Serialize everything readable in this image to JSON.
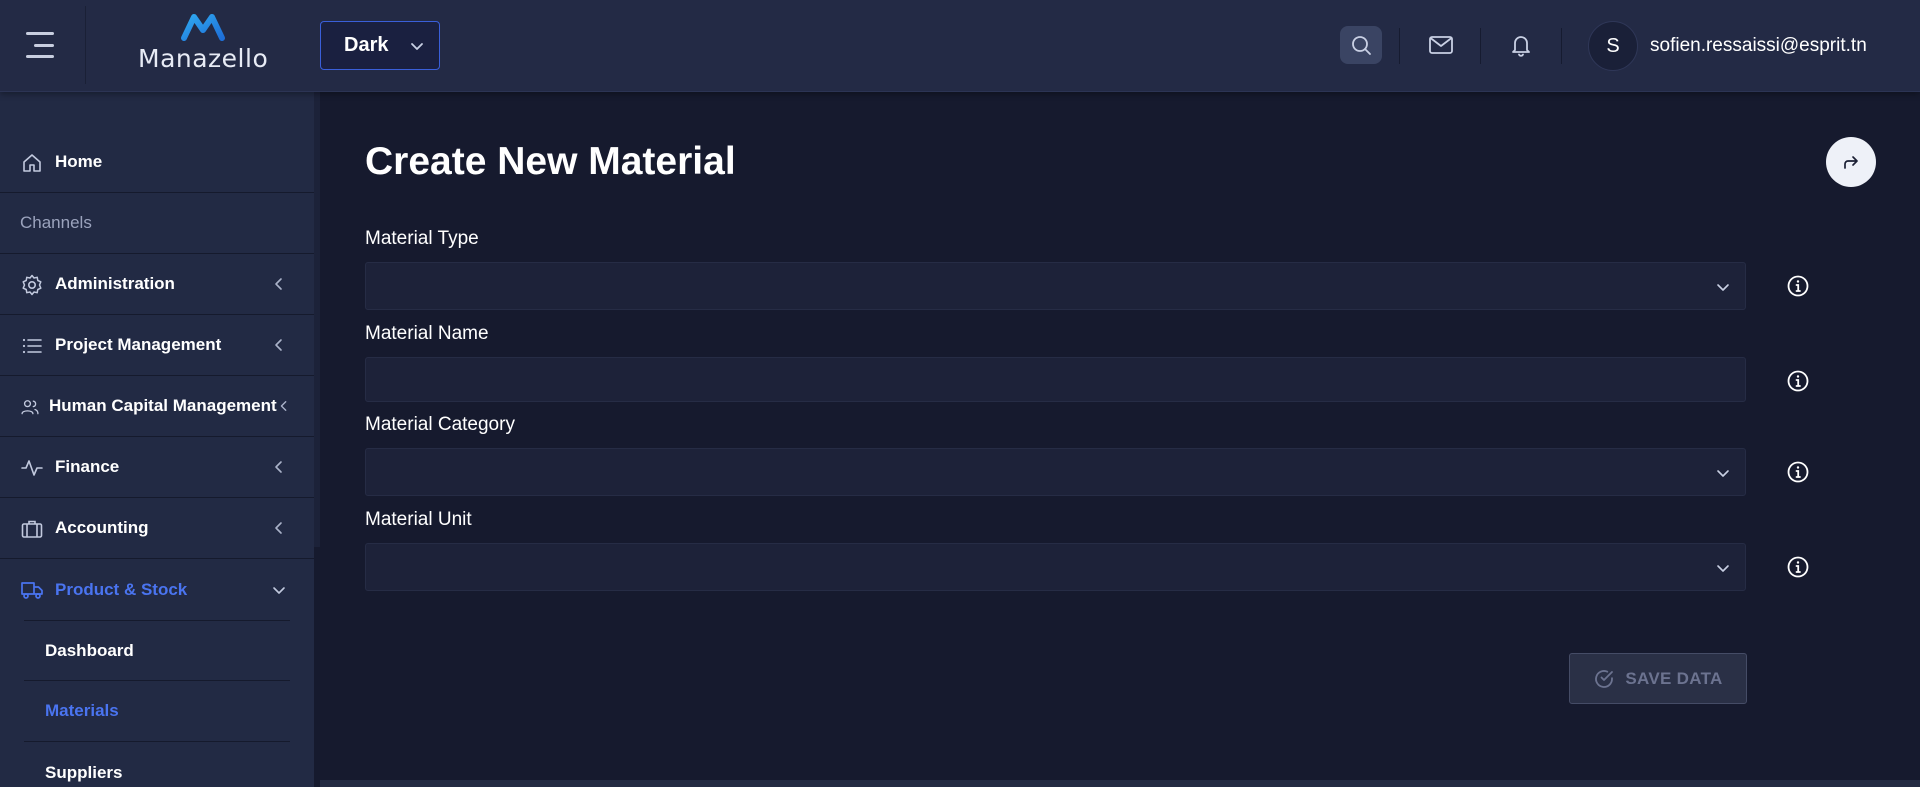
{
  "header": {
    "brand": "Manazello",
    "theme": {
      "selected": "Dark"
    },
    "user": {
      "initial": "S",
      "email": "sofien.ressaissi@esprit.tn"
    }
  },
  "sidebar": {
    "items": [
      {
        "label": "Home",
        "icon": "home-icon"
      },
      {
        "label": "Channels",
        "heading": true
      },
      {
        "label": "Administration",
        "icon": "gear-icon",
        "expandable": true
      },
      {
        "label": "Project Management",
        "icon": "list-icon",
        "expandable": true
      },
      {
        "label": "Human Capital Management",
        "icon": "users-icon",
        "expandable": true
      },
      {
        "label": "Finance",
        "icon": "activity-icon",
        "expandable": true
      },
      {
        "label": "Accounting",
        "icon": "briefcase-icon",
        "expandable": true
      },
      {
        "label": "Product & Stock",
        "icon": "truck-icon",
        "expanded": true,
        "active": true
      }
    ],
    "sub_items": [
      {
        "label": "Dashboard"
      },
      {
        "label": "Materials",
        "active": true
      },
      {
        "label": "Suppliers"
      }
    ]
  },
  "main": {
    "title": "Create New Material",
    "fields": [
      {
        "label": "Material Type",
        "type": "select",
        "value": ""
      },
      {
        "label": "Material Name",
        "type": "text",
        "value": ""
      },
      {
        "label": "Material Category",
        "type": "select",
        "value": ""
      },
      {
        "label": "Material Unit",
        "type": "select",
        "value": ""
      }
    ],
    "save_label": "SAVE DATA"
  },
  "colors": {
    "topbar_bg": "#232a45",
    "sidebar_bg": "#222a44",
    "content_bg": "#161a2e",
    "accent_blue": "#4a74f0",
    "field_bg": "#1d2239"
  }
}
